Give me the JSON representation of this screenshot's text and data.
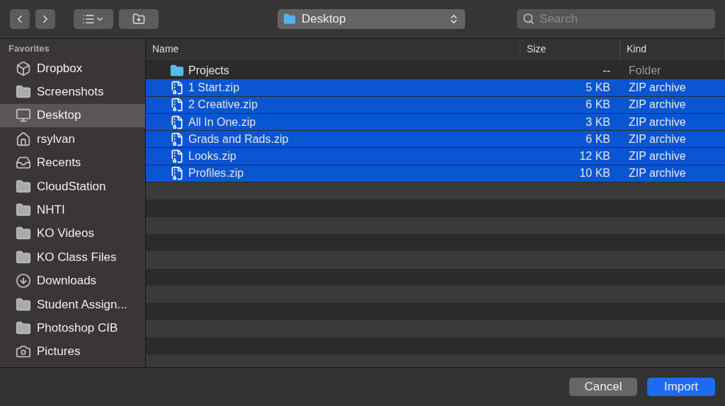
{
  "toolbar": {
    "location": "Desktop",
    "search": {
      "placeholder": "Search"
    }
  },
  "sidebar": {
    "heading": "Favorites",
    "items": [
      {
        "label": "Dropbox",
        "kind": "dropbox",
        "selected": false
      },
      {
        "label": "Screenshots",
        "kind": "folder",
        "selected": false
      },
      {
        "label": "Desktop",
        "kind": "desktop",
        "selected": true
      },
      {
        "label": "rsylvan",
        "kind": "home",
        "selected": false
      },
      {
        "label": "Recents",
        "kind": "recents",
        "selected": false
      },
      {
        "label": "CloudStation",
        "kind": "folder",
        "selected": false
      },
      {
        "label": "NHTI",
        "kind": "folder",
        "selected": false
      },
      {
        "label": "KO Videos",
        "kind": "folder",
        "selected": false
      },
      {
        "label": "KO Class Files",
        "kind": "folder",
        "selected": false
      },
      {
        "label": "Downloads",
        "kind": "downloads",
        "selected": false
      },
      {
        "label": "Student Assign...",
        "kind": "folder",
        "selected": false
      },
      {
        "label": "Photoshop CIB",
        "kind": "folder",
        "selected": false
      },
      {
        "label": "Pictures",
        "kind": "camera",
        "selected": false
      }
    ]
  },
  "table": {
    "columns": [
      "Name",
      "Size",
      "Kind"
    ],
    "rows": [
      {
        "name": "Projects",
        "size": "--",
        "kind_text": "Folder",
        "kind": "folder",
        "selected": false
      },
      {
        "name": "1 Start.zip",
        "size": "5 KB",
        "kind_text": "ZIP archive",
        "kind": "zip",
        "selected": true
      },
      {
        "name": "2 Creative.zip",
        "size": "6 KB",
        "kind_text": "ZIP archive",
        "kind": "zip",
        "selected": true
      },
      {
        "name": "All In One.zip",
        "size": "3 KB",
        "kind_text": "ZIP archive",
        "kind": "zip",
        "selected": true
      },
      {
        "name": "Grads and Rads.zip",
        "size": "6 KB",
        "kind_text": "ZIP archive",
        "kind": "zip",
        "selected": true
      },
      {
        "name": "Looks.zip",
        "size": "12 KB",
        "kind_text": "ZIP archive",
        "kind": "zip",
        "selected": true
      },
      {
        "name": "Profiles.zip",
        "size": "10 KB",
        "kind_text": "ZIP archive",
        "kind": "zip",
        "selected": true
      }
    ]
  },
  "buttons": {
    "cancel": "Cancel",
    "import": "Import"
  }
}
